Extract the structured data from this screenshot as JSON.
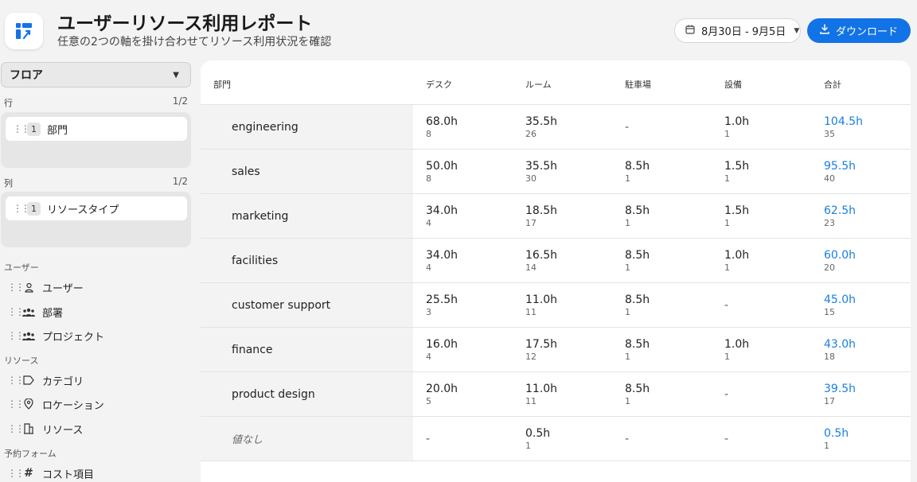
{
  "header": {
    "title": "ユーザーリソース利用レポート",
    "subtitle": "任意の2つの軸を掛け合わせてリソース利用状況を確認",
    "date_range": "8月30日 - 9月5日",
    "download_label": "ダウンロード"
  },
  "sidebar": {
    "floor_select": "フロア",
    "rows": {
      "label": "行",
      "count": "1/2",
      "chip_num": "1",
      "chip_label": "部門"
    },
    "cols": {
      "label": "列",
      "count": "1/2",
      "chip_num": "1",
      "chip_label": "リソースタイプ"
    },
    "groups": [
      {
        "label": "ユーザー",
        "items": [
          "ユーザー",
          "部署",
          "プロジェクト"
        ]
      },
      {
        "label": "リソース",
        "items": [
          "カテゴリ",
          "ロケーション",
          "リソース"
        ]
      },
      {
        "label": "予約フォーム",
        "items": [
          "コスト項目"
        ]
      }
    ]
  },
  "table": {
    "headers": [
      "部門",
      "デスク",
      "ルーム",
      "駐車場",
      "設備",
      "合計"
    ],
    "rows": [
      {
        "name": "engineering",
        "cells": [
          [
            "68.0h",
            "8"
          ],
          [
            "35.5h",
            "26"
          ],
          [
            "-",
            ""
          ],
          [
            "1.0h",
            "1"
          ]
        ],
        "total": [
          "104.5h",
          "35"
        ]
      },
      {
        "name": "sales",
        "cells": [
          [
            "50.0h",
            "8"
          ],
          [
            "35.5h",
            "30"
          ],
          [
            "8.5h",
            "1"
          ],
          [
            "1.5h",
            "1"
          ]
        ],
        "total": [
          "95.5h",
          "40"
        ]
      },
      {
        "name": "marketing",
        "cells": [
          [
            "34.0h",
            "4"
          ],
          [
            "18.5h",
            "17"
          ],
          [
            "8.5h",
            "1"
          ],
          [
            "1.5h",
            "1"
          ]
        ],
        "total": [
          "62.5h",
          "23"
        ]
      },
      {
        "name": "facilities",
        "cells": [
          [
            "34.0h",
            "4"
          ],
          [
            "16.5h",
            "14"
          ],
          [
            "8.5h",
            "1"
          ],
          [
            "1.0h",
            "1"
          ]
        ],
        "total": [
          "60.0h",
          "20"
        ]
      },
      {
        "name": "customer support",
        "cells": [
          [
            "25.5h",
            "3"
          ],
          [
            "11.0h",
            "11"
          ],
          [
            "8.5h",
            "1"
          ],
          [
            "-",
            ""
          ]
        ],
        "total": [
          "45.0h",
          "15"
        ]
      },
      {
        "name": "finance",
        "cells": [
          [
            "16.0h",
            "4"
          ],
          [
            "17.5h",
            "12"
          ],
          [
            "8.5h",
            "1"
          ],
          [
            "1.0h",
            "1"
          ]
        ],
        "total": [
          "43.0h",
          "18"
        ]
      },
      {
        "name": "product design",
        "cells": [
          [
            "20.0h",
            "5"
          ],
          [
            "11.0h",
            "11"
          ],
          [
            "8.5h",
            "1"
          ],
          [
            "-",
            ""
          ]
        ],
        "total": [
          "39.5h",
          "17"
        ]
      },
      {
        "name": "値なし",
        "cells": [
          [
            "-",
            ""
          ],
          [
            "0.5h",
            "1"
          ],
          [
            "-",
            ""
          ],
          [
            "-",
            ""
          ]
        ],
        "total": [
          "0.5h",
          "1"
        ]
      }
    ]
  },
  "colors": {
    "accent": "#1273e6",
    "total_text": "#1a7fe0"
  }
}
